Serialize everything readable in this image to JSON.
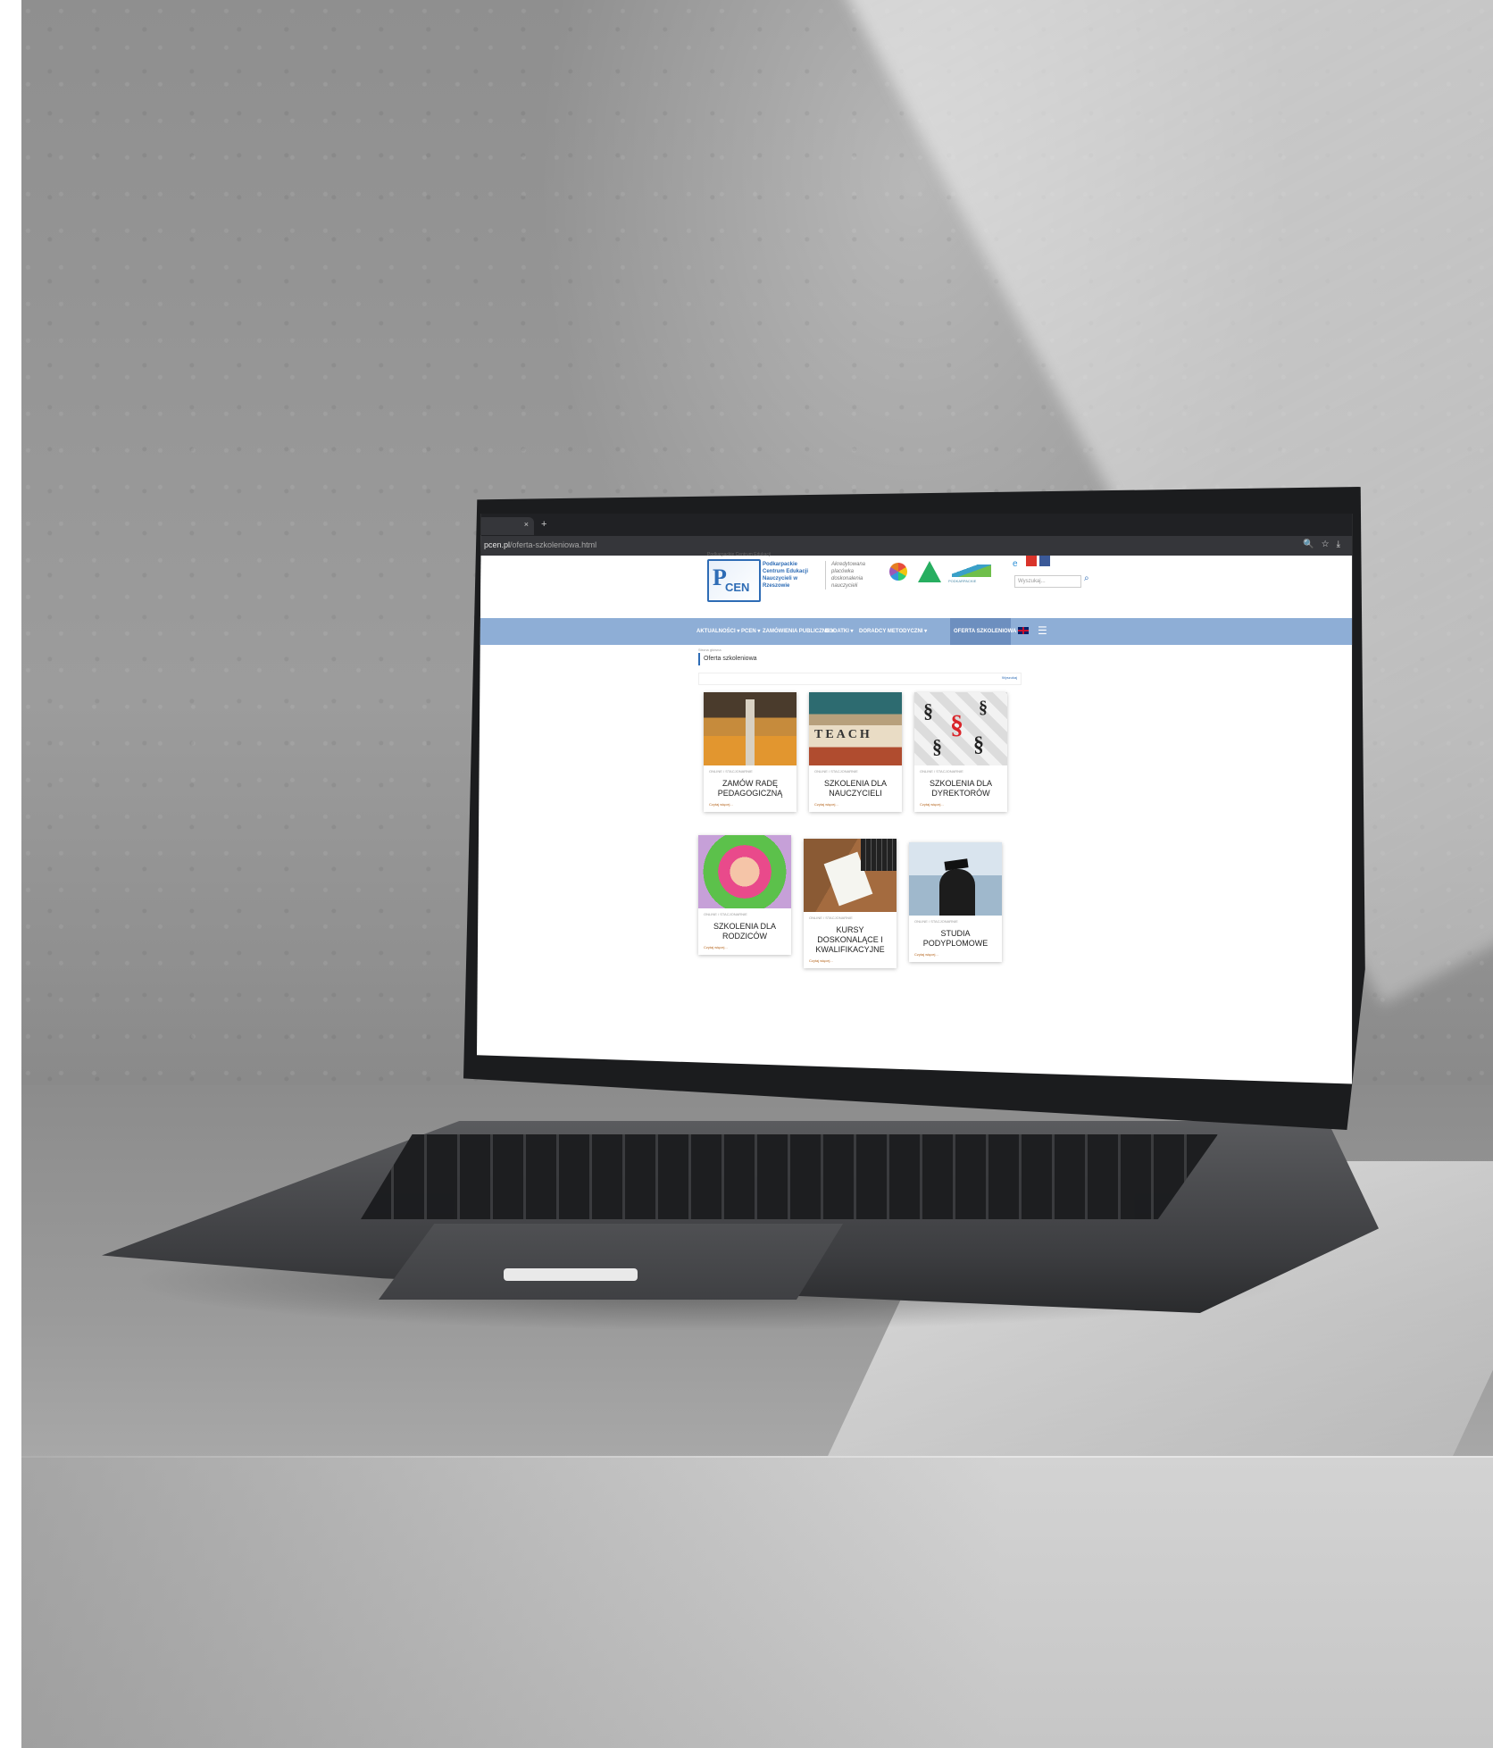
{
  "browser": {
    "tab_close": "×",
    "tab_new": "+",
    "url_host": "pcen.pl",
    "url_path": "/oferta-szkoleniowa.html",
    "chrome_icons": "🔍☆⤓"
  },
  "header": {
    "org_super": "Podkarpackie Centrum Edukacji",
    "logo_letter": "P",
    "logo_sub": "CEN",
    "org_name": "Podkarpackie Centrum Edukacji Nauczycieli w Rzeszowie",
    "accreditation": "Akredytowana placówka doskonalenia nauczycieli",
    "partner3_label": "PODKARPACKIE",
    "search_placeholder": "Wyszukaj...",
    "search_icon": "search-icon"
  },
  "nav": {
    "items": [
      "AKTUALNOŚCI ▾",
      "PCEN ▾",
      "ZAMÓWIENIA PUBLICZNE ▾",
      "DODATKI ▾",
      "DORADCY METODYCZNI ▾",
      "OFERTA SZKOLENIOWA ▾"
    ],
    "hamburger": "☰"
  },
  "content": {
    "breadcrumb": "Strona główna",
    "page_title": "Oferta szkoleniowa",
    "filter_link": "Wyszukaj",
    "cards": [
      {
        "tag": "ONLINE / STACJONARNIE",
        "title": "ZAMÓW RADĘ PEDAGOGICZNĄ",
        "more": "Czytaj więcej..."
      },
      {
        "tag": "ONLINE / STACJONARNIE",
        "title": "SZKOLENIA DLA NAUCZYCIELI",
        "more": "Czytaj więcej...",
        "image_text": "TEACH"
      },
      {
        "tag": "ONLINE / STACJONARNIE",
        "title": "SZKOLENIA DLA DYREKTORÓW",
        "more": "Czytaj więcej..."
      },
      {
        "tag": "ONLINE / STACJONARNIE",
        "title": "SZKOLENIA DLA RODZICÓW",
        "more": "Czytaj więcej..."
      },
      {
        "tag": "ONLINE / STACJONARNIE",
        "title": "KURSY DOSKONALĄCE I KWALIFIKACYJNE",
        "more": "Czytaj więcej..."
      },
      {
        "tag": "ONLINE / STACJONARNIE",
        "title": "STUDIA PODYPLOMOWE",
        "more": "Czytaj więcej..."
      }
    ]
  },
  "colors": {
    "nav_bg": "#8eaed6",
    "nav_active": "#6d8fbf",
    "brand_blue": "#2e6cb5"
  }
}
